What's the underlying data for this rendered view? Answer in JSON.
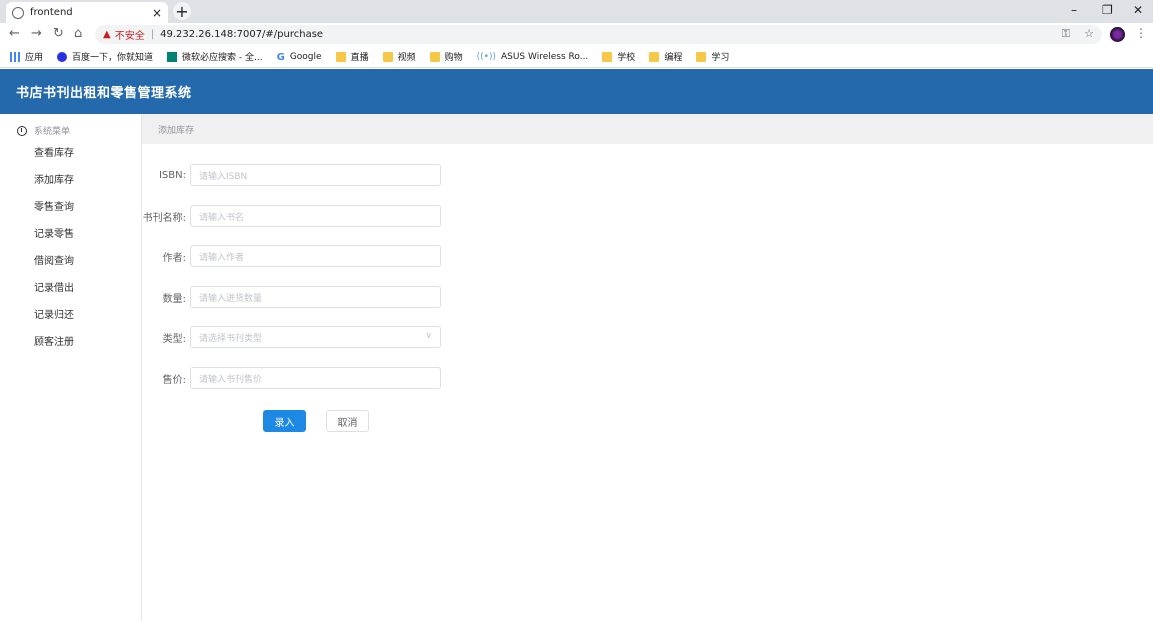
{
  "browser": {
    "tab_title": "frontend",
    "tab_close": "×",
    "new_tab": "+",
    "security_label": "不安全",
    "url": "49.232.26.148:7007/#/purchase",
    "bookmarks": [
      {
        "label": "应用",
        "icon": "apps-icon"
      },
      {
        "label": "百度一下，你就知道",
        "icon": "baidu-icon"
      },
      {
        "label": "微软必应搜索 - 全...",
        "icon": "bing-icon"
      },
      {
        "label": "Google",
        "icon": "google-icon"
      },
      {
        "label": "直播",
        "icon": "folder-icon"
      },
      {
        "label": "视频",
        "icon": "folder-icon"
      },
      {
        "label": "购物",
        "icon": "folder-icon"
      },
      {
        "label": "ASUS Wireless Ro...",
        "icon": "asus-icon"
      },
      {
        "label": "学校",
        "icon": "folder-icon"
      },
      {
        "label": "编程",
        "icon": "folder-icon"
      },
      {
        "label": "学习",
        "icon": "folder-icon"
      }
    ]
  },
  "app": {
    "title": "书店书刊出租和零售管理系统",
    "accent_color": "#2569ad"
  },
  "sidebar": {
    "group_label": "系统菜单",
    "items": [
      {
        "label": "查看库存"
      },
      {
        "label": "添加库存"
      },
      {
        "label": "零售查询"
      },
      {
        "label": "记录零售"
      },
      {
        "label": "借阅查询"
      },
      {
        "label": "记录借出"
      },
      {
        "label": "记录归还"
      },
      {
        "label": "顾客注册"
      }
    ]
  },
  "breadcrumb": "添加库存",
  "form": {
    "fields": [
      {
        "label": "ISBN:",
        "placeholder": "请输入ISBN",
        "value": ""
      },
      {
        "label": "书刊名称:",
        "placeholder": "请输入书名",
        "value": ""
      },
      {
        "label": "作者:",
        "placeholder": "请输入作者",
        "value": ""
      },
      {
        "label": "数量:",
        "placeholder": "请输入进货数量",
        "value": ""
      },
      {
        "label": "类型:",
        "placeholder": "请选择书刊类型",
        "value": ""
      },
      {
        "label": "售价:",
        "placeholder": "请输入书刊售价",
        "value": ""
      }
    ],
    "submit_label": "录入",
    "cancel_label": "取消",
    "primary_color": "#1e88e5"
  }
}
